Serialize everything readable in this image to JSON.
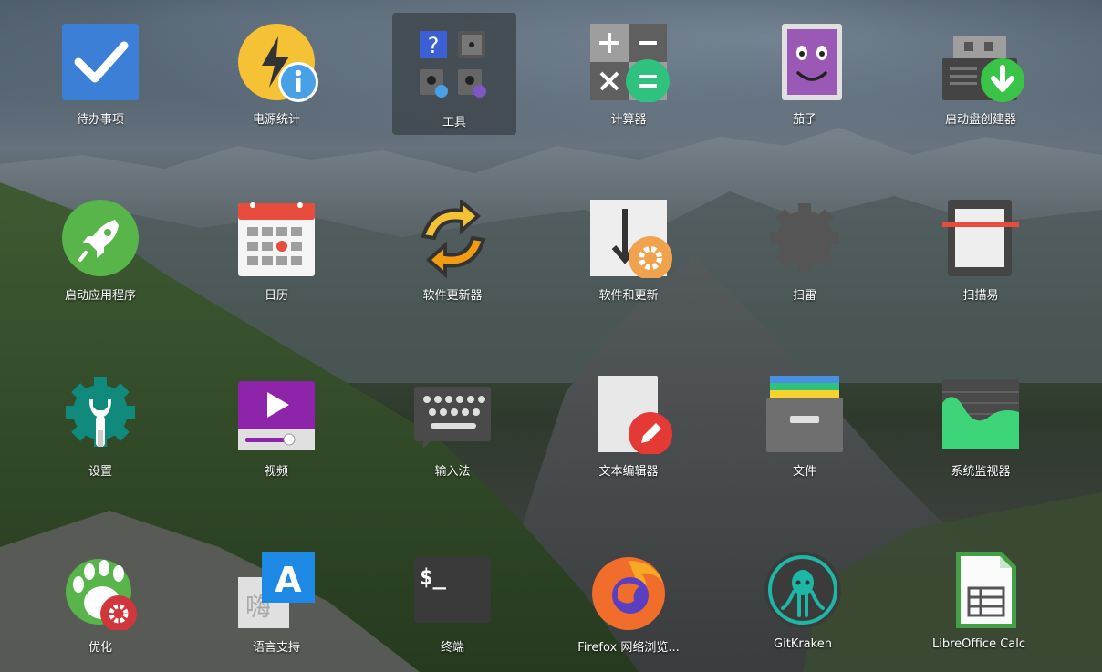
{
  "apps": [
    {
      "name": "app-todo",
      "icon": "checkmark-icon",
      "label": "待办事项"
    },
    {
      "name": "app-power-statistics",
      "icon": "power-info-icon",
      "label": "电源统计"
    },
    {
      "name": "app-tools-folder",
      "icon": "tools-folder-icon",
      "label": "工具",
      "selected": true
    },
    {
      "name": "app-calculator",
      "icon": "calculator-icon",
      "label": "计算器"
    },
    {
      "name": "app-cheese",
      "icon": "cheese-face-icon",
      "label": "茄子"
    },
    {
      "name": "app-startup-disk-creator",
      "icon": "usb-download-icon",
      "label": "启动盘创建器"
    },
    {
      "name": "app-launcher",
      "icon": "rocket-icon",
      "label": "启动应用程序"
    },
    {
      "name": "app-calendar",
      "icon": "calendar-icon",
      "label": "日历"
    },
    {
      "name": "app-software-updater",
      "icon": "update-arrows-icon",
      "label": "软件更新器"
    },
    {
      "name": "app-software-and-updates",
      "icon": "download-gear-icon",
      "label": "软件和更新"
    },
    {
      "name": "app-mines",
      "icon": "mine-gear-icon",
      "label": "扫雷"
    },
    {
      "name": "app-simple-scan",
      "icon": "scanner-icon",
      "label": "扫描易"
    },
    {
      "name": "app-settings",
      "icon": "wrench-gear-icon",
      "label": "设置"
    },
    {
      "name": "app-videos",
      "icon": "video-player-icon",
      "label": "视频"
    },
    {
      "name": "app-input-method",
      "icon": "keyboard-icon",
      "label": "输入法"
    },
    {
      "name": "app-text-editor",
      "icon": "document-pencil-icon",
      "label": "文本编辑器"
    },
    {
      "name": "app-files",
      "icon": "file-cabinet-icon",
      "label": "文件"
    },
    {
      "name": "app-system-monitor",
      "icon": "system-monitor-icon",
      "label": "系统监视器"
    },
    {
      "name": "app-tweaks",
      "icon": "gnome-foot-gear-icon",
      "label": "优化"
    },
    {
      "name": "app-language-support",
      "icon": "language-a-icon",
      "label": "语言支持"
    },
    {
      "name": "app-terminal",
      "icon": "terminal-icon",
      "label": "终端"
    },
    {
      "name": "app-firefox",
      "icon": "firefox-icon",
      "label": "Firefox 网络浏览..."
    },
    {
      "name": "app-gitkraken",
      "icon": "gitkraken-icon",
      "label": "GitKraken"
    },
    {
      "name": "app-libreoffice-calc",
      "icon": "spreadsheet-icon",
      "label": "LibreOffice Calc"
    }
  ],
  "icon_text": {
    "terminal_prompt": "$_",
    "language_letter": "A",
    "language_glyph": "嗨",
    "tools_question": "?"
  },
  "colors": {
    "todo_blue": "#3c7fd6",
    "power_yellow": "#f6c235",
    "info_blue": "#48a1e6",
    "calc_green": "#2ec27e",
    "cheese_purple": "#9b59b6",
    "usb_green": "#39c447",
    "rocket_green": "#57b54a",
    "calendar_red": "#e74c3c",
    "updater_orange": "#f39c12",
    "settings_teal": "#108a7c",
    "video_purple": "#8e24aa",
    "editor_red": "#e53935",
    "files_grey": "#6f6f6f",
    "monitor_green": "#3ed47a",
    "tweaks_red": "#d0373c",
    "lang_blue": "#1e88e5",
    "firefox_orange": "#f06d2c",
    "gitkraken_teal": "#1eb6a6",
    "calc_doc_green": "#43a047"
  }
}
